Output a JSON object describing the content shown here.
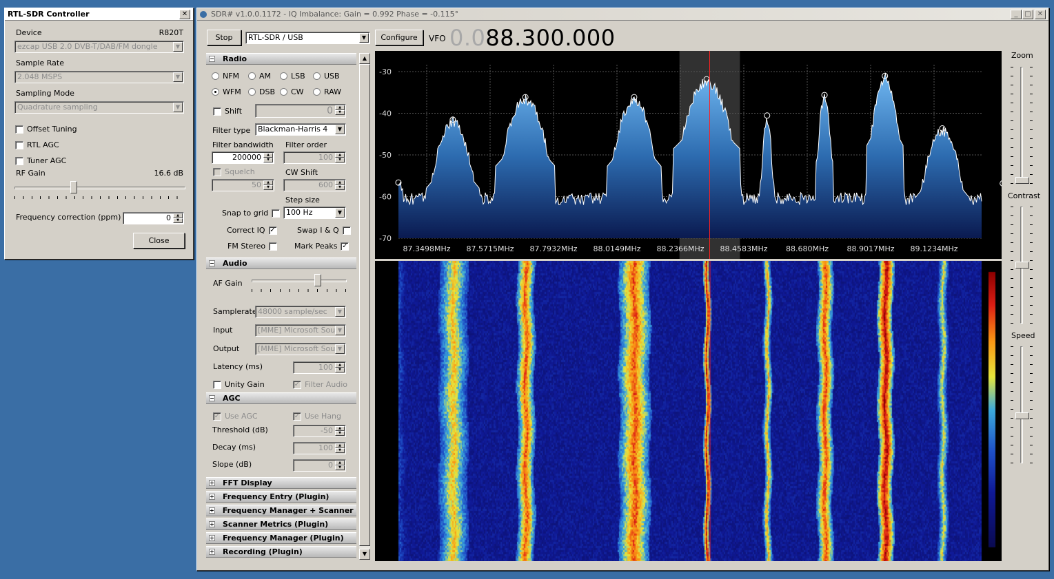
{
  "rtl_dialog": {
    "title": "RTL-SDR Controller",
    "device_label": "Device",
    "device_tuner": "R820T",
    "device_value": "ezcap USB 2.0 DVB-T/DAB/FM dongle",
    "sample_rate_label": "Sample Rate",
    "sample_rate_value": "2.048 MSPS",
    "sampling_mode_label": "Sampling Mode",
    "sampling_mode_value": "Quadrature sampling",
    "offset_tuning": "Offset Tuning",
    "rtl_agc": "RTL AGC",
    "tuner_agc": "Tuner AGC",
    "rf_gain_label": "RF Gain",
    "rf_gain_value": "16.6 dB",
    "rf_gain_level": 0.34,
    "freq_corr_label": "Frequency correction (ppm)",
    "freq_corr_value": "0",
    "close_label": "Close"
  },
  "main": {
    "title": "SDR# v1.0.0.1172 - IQ Imbalance: Gain = 0.992 Phase = -0.115°",
    "stop_label": "Stop",
    "source_value": "RTL-SDR / USB",
    "configure_label": "Configure",
    "vfo_label": "VFO",
    "vfo_dim": "0.0",
    "vfo_value": "88.300.000"
  },
  "radio": {
    "header": "Radio",
    "modes": [
      "NFM",
      "AM",
      "LSB",
      "USB",
      "WFM",
      "DSB",
      "CW",
      "RAW"
    ],
    "selected_mode": "WFM",
    "shift_label": "Shift",
    "shift_value": "0",
    "filter_type_label": "Filter type",
    "filter_type_value": "Blackman-Harris 4",
    "filter_bw_label": "Filter bandwidth",
    "filter_bw_value": "200000",
    "filter_order_label": "Filter order",
    "filter_order_value": "100",
    "squelch_label": "Squelch",
    "squelch_value": "50",
    "cw_shift_label": "CW Shift",
    "cw_shift_value": "600",
    "step_size_label": "Step size",
    "snap_label": "Snap to grid",
    "step_size_value": "100 Hz",
    "correct_iq_label": "Correct IQ",
    "swap_iq_label": "Swap I & Q",
    "fm_stereo_label": "FM Stereo",
    "mark_peaks_label": "Mark Peaks"
  },
  "audio": {
    "header": "Audio",
    "af_gain_label": "AF Gain",
    "af_gain_level": 0.71,
    "samplerate_label": "Samplerate",
    "samplerate_value": "48000 sample/sec",
    "input_label": "Input",
    "input_value": "[MME] Microsoft Sound",
    "output_label": "Output",
    "output_value": "[MME] Microsoft Sound",
    "latency_label": "Latency (ms)",
    "latency_value": "100",
    "unity_gain_label": "Unity Gain",
    "filter_audio_label": "Filter Audio"
  },
  "agc": {
    "header": "AGC",
    "use_agc_label": "Use AGC",
    "use_hang_label": "Use Hang",
    "threshold_label": "Threshold (dB)",
    "threshold_value": "-50",
    "decay_label": "Decay (ms)",
    "decay_value": "100",
    "slope_label": "Slope (dB)",
    "slope_value": "0"
  },
  "plugins": [
    "FFT Display",
    "Frequency Entry (Plugin)",
    "Frequency Manager + Scanner (Plug",
    "Scanner Metrics (Plugin)",
    "Frequency Manager (Plugin)",
    "Recording (Plugin)"
  ],
  "right_panel": {
    "zoom_label": "Zoom",
    "zoom_level": 0.0,
    "contrast_label": "Contrast",
    "contrast_level": 0.5,
    "speed_label": "Speed",
    "speed_level": 0.4
  },
  "spectrum": {
    "y_ticks": [
      "-30",
      "-40",
      "-50",
      "-60",
      "-70"
    ],
    "x_ticks": [
      "87.3498MHz",
      "87.5715MHz",
      "87.7932MHz",
      "88.0149MHz",
      "88.2366MHz",
      "88.4583MHz",
      "88.680MHz",
      "88.9017MHz",
      "89.1234MHz"
    ]
  },
  "colors": {
    "window_bg": "#d4d0c8",
    "desktop": "#3a6ea5",
    "vfo_line": "#ff2020",
    "spectrum_fill": "#3a7fc0"
  },
  "chart_data": {
    "type": "area",
    "xlabel": "",
    "ylabel": "",
    "x_range_mhz": [
      87.27,
      89.2
    ],
    "ylim": [
      -70,
      -28
    ],
    "vfo_mhz": 88.3,
    "filter_band_mhz": [
      88.2,
      88.4
    ],
    "peaks": [
      {
        "f": 87.27,
        "db": -57.3
      },
      {
        "f": 87.45,
        "db": -42.2
      },
      {
        "f": 87.69,
        "db": -36.8
      },
      {
        "f": 88.05,
        "db": -36.8
      },
      {
        "f": 88.29,
        "db": -32.5
      },
      {
        "f": 88.49,
        "db": -41.2
      },
      {
        "f": 88.68,
        "db": -36.3
      },
      {
        "f": 88.88,
        "db": -31.7
      },
      {
        "f": 89.07,
        "db": -44.3
      },
      {
        "f": 89.27,
        "db": -57.5
      }
    ],
    "noise_floor_db": -60
  }
}
